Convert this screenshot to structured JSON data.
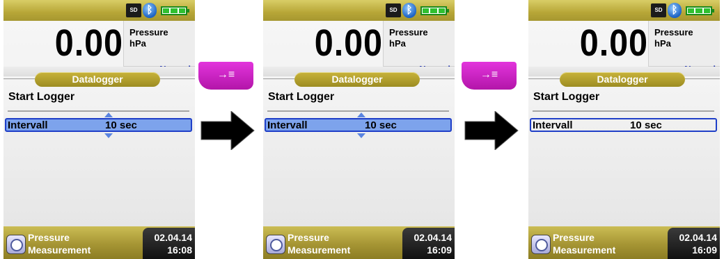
{
  "status": {
    "sd_label": "SD",
    "bluetooth_icon": "bluetooth-icon",
    "battery_icon": "battery-icon"
  },
  "header": {
    "value": "0.00",
    "measurement_name": "Pressure",
    "unit": "hPa",
    "mode": "Normal"
  },
  "menu": {
    "tab_label": "Datalogger",
    "start_label": "Start Logger",
    "interval_label": "Intervall",
    "interval_value": "10 sec"
  },
  "footer": {
    "label_line1": "Pressure",
    "label_line2": "Measurement",
    "date": "02.04.14"
  },
  "screens": [
    {
      "time": "16:08"
    },
    {
      "time": "16:09"
    },
    {
      "time": "16:09"
    }
  ],
  "key_icon": "enter-list-icon",
  "key_glyph": "→≡",
  "arrow_icon": "right-arrow-icon",
  "colors": {
    "status_bar": "#b7a637",
    "selection": "#7da3ec",
    "selection_border": "#1f3fc8",
    "key": "#c920c0",
    "mode_text": "#1c2ea8"
  }
}
